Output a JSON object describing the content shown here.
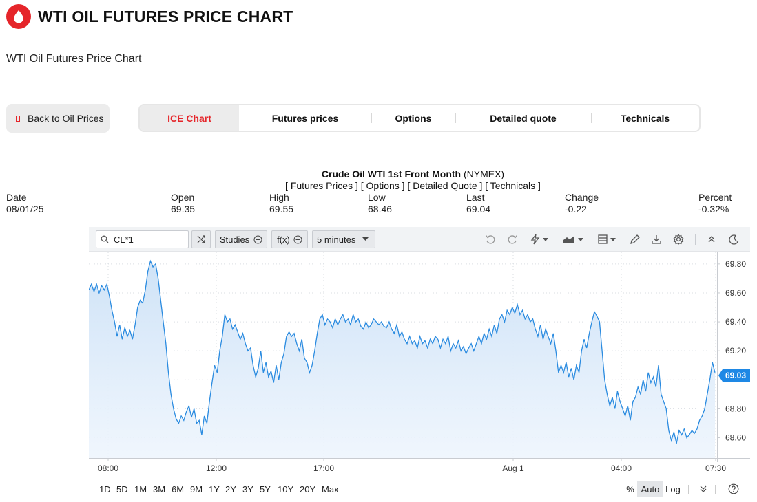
{
  "header": {
    "title": "WTI OIL FUTURES PRICE CHART",
    "subtitle": "WTI Oil Futures Price Chart",
    "brand_color": "#e5252a"
  },
  "back_button": {
    "label": "Back to Oil Prices"
  },
  "tabs": [
    {
      "label": "ICE Chart",
      "active": true
    },
    {
      "label": "Futures prices",
      "active": false
    },
    {
      "label": "Options",
      "active": false
    },
    {
      "label": "Detailed quote",
      "active": false
    },
    {
      "label": "Technicals",
      "active": false
    }
  ],
  "chart_header": {
    "title": "Crude Oil WTI 1st Front Month",
    "exchange": "(NYMEX)",
    "links": "[ Futures Prices ] [ Options ] [ Detailed Quote ] [ Technicals ]"
  },
  "stats": {
    "date_label": "Date",
    "date_value": "08/01/25",
    "open_label": "Open",
    "open_value": "69.35",
    "high_label": "High",
    "high_value": "69.55",
    "low_label": "Low",
    "low_value": "68.46",
    "last_label": "Last",
    "last_value": "69.04",
    "change_label": "Change",
    "change_value": "-0.22",
    "percent_label": "Percent",
    "percent_value": "-0.32%"
  },
  "toolbar": {
    "symbol": "CL*1",
    "studies_label": "Studies",
    "fx_label": "f(x)",
    "interval_label": "5 minutes",
    "icons": [
      "compare-icon",
      "undo-icon",
      "redo-icon",
      "events-icon",
      "chart-type-icon",
      "layout-icon",
      "draw-icon",
      "download-icon",
      "settings-icon",
      "collapse-icon",
      "theme-icon"
    ]
  },
  "bottom_bar": {
    "ranges": [
      "1D",
      "5D",
      "1M",
      "3M",
      "6M",
      "9M",
      "1Y",
      "2Y",
      "3Y",
      "5Y",
      "10Y",
      "20Y",
      "Max"
    ],
    "scales": [
      "%",
      "Auto",
      "Log"
    ],
    "active_scale": "Auto"
  },
  "chart_data": {
    "type": "area",
    "title": "",
    "xlabel": "",
    "ylabel": "",
    "x_ticks": [
      "08:00",
      "12:00",
      "17:00",
      "Aug 1",
      "04:00",
      "07:30"
    ],
    "y_ticks": [
      68.6,
      68.8,
      69.0,
      69.2,
      69.4,
      69.6,
      69.8
    ],
    "y_tick_labels": [
      "68.60",
      "68.80",
      "69.20",
      "69.40",
      "69.60",
      "69.80"
    ],
    "ylim": [
      68.46,
      69.88
    ],
    "last_price_label": "69.03",
    "line_color": "#2a8be0",
    "grid": true,
    "series": [
      {
        "values": [
          69.62,
          69.66,
          69.61,
          69.66,
          69.6,
          69.65,
          69.62,
          69.66,
          69.58,
          69.48,
          69.4,
          69.3,
          69.38,
          69.28,
          69.36,
          69.3,
          69.34,
          69.28,
          69.38,
          69.5,
          69.55,
          69.53,
          69.62,
          69.75,
          69.82,
          69.78,
          69.8,
          69.7,
          69.55,
          69.4,
          69.25,
          69.05,
          68.9,
          68.8,
          68.73,
          68.7,
          68.75,
          68.72,
          68.78,
          68.82,
          68.74,
          68.8,
          68.7,
          68.72,
          68.62,
          68.75,
          68.7,
          68.85,
          68.98,
          69.1,
          69.05,
          69.2,
          69.3,
          69.45,
          69.4,
          69.42,
          69.35,
          69.38,
          69.33,
          69.28,
          69.32,
          69.25,
          69.2,
          69.22,
          69.1,
          69.02,
          69.08,
          69.2,
          69.05,
          69.12,
          69.02,
          69.06,
          68.98,
          69.1,
          69.0,
          69.12,
          69.18,
          69.3,
          69.33,
          69.3,
          69.32,
          69.25,
          69.2,
          69.28,
          69.15,
          69.12,
          69.05,
          69.1,
          69.2,
          69.32,
          69.42,
          69.45,
          69.38,
          69.42,
          69.4,
          69.36,
          69.42,
          69.38,
          69.42,
          69.45,
          69.4,
          69.42,
          69.38,
          69.45,
          69.4,
          69.42,
          69.37,
          69.35,
          69.4,
          69.36,
          69.38,
          69.42,
          69.4,
          69.38,
          69.4,
          69.37,
          69.36,
          69.4,
          69.35,
          69.32,
          69.38,
          69.3,
          69.33,
          69.28,
          69.25,
          69.3,
          69.25,
          69.27,
          69.22,
          69.3,
          69.25,
          69.27,
          69.22,
          69.28,
          69.25,
          69.3,
          69.28,
          69.22,
          69.28,
          69.25,
          69.3,
          69.2,
          69.25,
          69.22,
          69.27,
          69.2,
          69.23,
          69.18,
          69.22,
          69.25,
          69.2,
          69.25,
          69.3,
          69.25,
          69.32,
          69.28,
          69.35,
          69.3,
          69.38,
          69.32,
          69.42,
          69.45,
          69.4,
          69.48,
          69.45,
          69.5,
          69.46,
          69.52,
          69.45,
          69.48,
          69.42,
          69.45,
          69.4,
          69.42,
          69.35,
          69.3,
          69.38,
          69.28,
          69.35,
          69.3,
          69.25,
          69.32,
          69.2,
          69.05,
          69.1,
          69.05,
          69.12,
          69.02,
          69.08,
          69.0,
          69.1,
          69.05,
          69.2,
          69.28,
          69.22,
          69.32,
          69.4,
          69.47,
          69.44,
          69.4,
          69.2,
          69.0,
          68.9,
          68.82,
          68.88,
          68.8,
          68.92,
          68.85,
          68.8,
          68.75,
          68.82,
          68.72,
          68.85,
          68.88,
          68.95,
          68.9,
          69.0,
          68.92,
          69.05,
          68.98,
          69.02,
          68.95,
          69.1,
          68.9,
          68.85,
          68.8,
          68.65,
          68.58,
          68.64,
          68.56,
          68.65,
          68.62,
          68.66,
          68.6,
          68.62,
          68.65,
          68.63,
          68.66,
          68.72,
          68.75,
          68.8,
          68.9,
          69.0,
          69.12,
          69.05
        ]
      }
    ]
  }
}
